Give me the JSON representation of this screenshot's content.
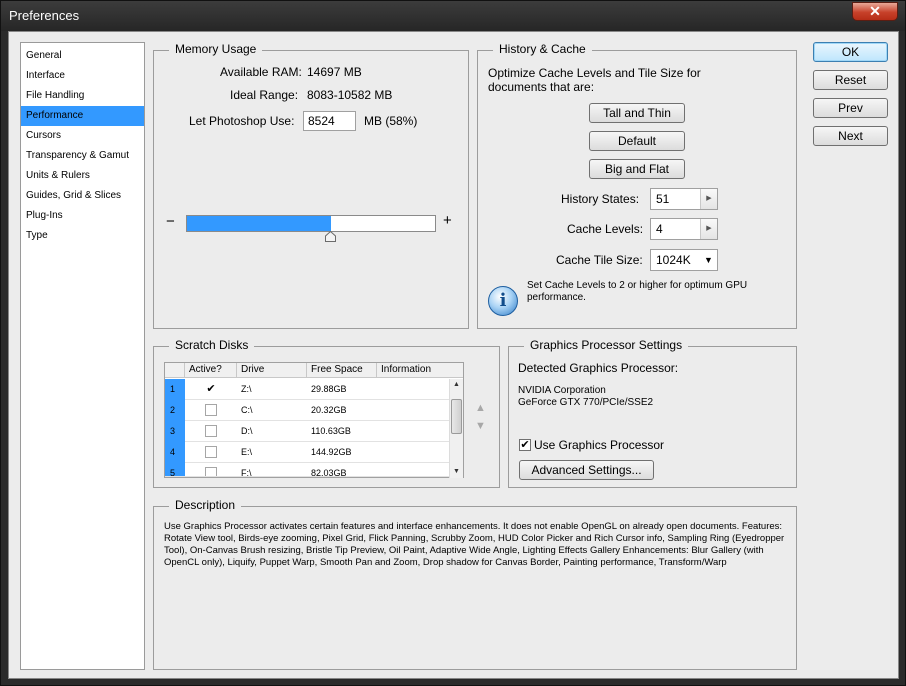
{
  "window": {
    "title": "Preferences",
    "close_symbol": "✕"
  },
  "sidebar": {
    "items": [
      {
        "label": "General"
      },
      {
        "label": "Interface"
      },
      {
        "label": "File Handling"
      },
      {
        "label": "Performance",
        "selected": true
      },
      {
        "label": "Cursors"
      },
      {
        "label": "Transparency & Gamut"
      },
      {
        "label": "Units & Rulers"
      },
      {
        "label": "Guides, Grid & Slices"
      },
      {
        "label": "Plug-Ins"
      },
      {
        "label": "Type"
      }
    ]
  },
  "memory": {
    "title": "Memory Usage",
    "available_label": "Available RAM:",
    "available_value": "14697 MB",
    "range_label": "Ideal Range:",
    "range_value": "8083-10582 MB",
    "use_label": "Let Photoshop Use:",
    "use_value": "8524",
    "use_suffix": "MB (58%)",
    "minus": "−",
    "plus": "+",
    "slider_fraction": 0.58
  },
  "history": {
    "title": "History & Cache",
    "intro": "Optimize Cache Levels and Tile Size for documents that are:",
    "buttons": [
      "Tall and Thin",
      "Default",
      "Big and Flat"
    ],
    "states_label": "History States:",
    "states_value": "51",
    "levels_label": "Cache Levels:",
    "levels_value": "4",
    "tile_label": "Cache Tile Size:",
    "tile_value": "1024K",
    "info_text": "Set Cache Levels to 2 or higher for optimum GPU performance.",
    "info_glyph": "i"
  },
  "scratch": {
    "title": "Scratch Disks",
    "columns": [
      "Active?",
      "Drive",
      "Free Space",
      "Information"
    ],
    "rows": [
      {
        "num": "1",
        "active": true,
        "drive": "Z:\\",
        "free": "29.88GB",
        "info": ""
      },
      {
        "num": "2",
        "active": false,
        "drive": "C:\\",
        "free": "20.32GB",
        "info": ""
      },
      {
        "num": "3",
        "active": false,
        "drive": "D:\\",
        "free": "110.63GB",
        "info": ""
      },
      {
        "num": "4",
        "active": false,
        "drive": "E:\\",
        "free": "144.92GB",
        "info": ""
      },
      {
        "num": "5",
        "active": false,
        "drive": "F:\\",
        "free": "82.03GB",
        "info": ""
      }
    ]
  },
  "gpu": {
    "title": "Graphics Processor Settings",
    "detected_label": "Detected Graphics Processor:",
    "vendor": "NVIDIA Corporation",
    "model": "GeForce GTX 770/PCIe/SSE2",
    "use_label": "Use Graphics Processor",
    "use_checked": true,
    "advanced_label": "Advanced Settings..."
  },
  "description": {
    "title": "Description",
    "text": "Use Graphics Processor activates certain features and interface enhancements. It does not enable OpenGL on already open documents. Features: Rotate View tool, Birds-eye zooming, Pixel Grid, Flick Panning, Scrubby Zoom, HUD Color Picker and Rich Cursor info, Sampling Ring (Eyedropper Tool), On-Canvas Brush resizing, Bristle Tip Preview, Oil Paint, Adaptive Wide Angle, Lighting Effects Gallery Enhancements: Blur Gallery (with OpenCL only), Liquify, Puppet Warp, Smooth Pan and Zoom, Drop shadow for Canvas Border, Painting performance, Transform/Warp"
  },
  "actions": {
    "ok": "OK",
    "reset": "Reset",
    "prev": "Prev",
    "next": "Next"
  },
  "colors": {
    "accent": "#3399ff",
    "panel": "#ececec",
    "title_bar": "#2b2b2b"
  }
}
